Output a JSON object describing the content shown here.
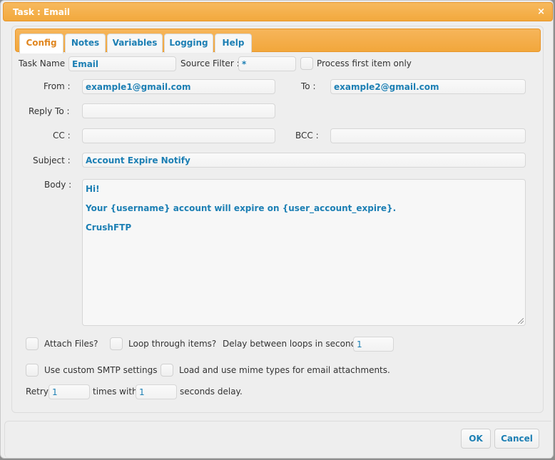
{
  "window": {
    "title": "Task : Email",
    "close_icon": "×"
  },
  "tabs": [
    {
      "label": "Config",
      "active": true
    },
    {
      "label": "Notes",
      "active": false
    },
    {
      "label": "Variables",
      "active": false
    },
    {
      "label": "Logging",
      "active": false
    },
    {
      "label": "Help",
      "active": false
    }
  ],
  "form": {
    "task_name_label": "Task Name :",
    "task_name_value": "Email",
    "source_filter_label": "Source Filter :",
    "source_filter_value": "*",
    "process_first_label": "Process first item only",
    "process_first_checked": false,
    "from_label": "From :",
    "from_value": "example1@gmail.com",
    "to_label": "To :",
    "to_value": "example2@gmail.com",
    "reply_to_label": "Reply To :",
    "reply_to_value": "",
    "cc_label": "CC :",
    "cc_value": "",
    "bcc_label": "BCC :",
    "bcc_value": "",
    "subject_label": "Subject :",
    "subject_value": "Account Expire Notify",
    "body_label": "Body :",
    "body_lines": [
      "Hi!",
      "Your {username} account will expire on {user_account_expire}.",
      "CrushFTP"
    ],
    "attach_files_label": "Attach Files?",
    "attach_files_checked": false,
    "loop_items_label": "Loop through items?",
    "loop_items_checked": false,
    "delay_loops_label": "Delay between loops in seconds :",
    "delay_loops_value": "1",
    "custom_smtp_label": "Use custom SMTP settings",
    "custom_smtp_checked": false,
    "mime_types_label": "Load and use mime types for email attachments.",
    "mime_types_checked": false,
    "retry_label": "Retry",
    "retry_value": "1",
    "times_with_label": "times with",
    "seconds_delay_value": "1",
    "seconds_delay_label": "seconds delay."
  },
  "footer": {
    "ok_label": "OK",
    "cancel_label": "Cancel"
  },
  "colors": {
    "accent_orange": "#f2a93d",
    "link_blue": "#1c7fb4",
    "active_tab_text": "#e0861f"
  }
}
